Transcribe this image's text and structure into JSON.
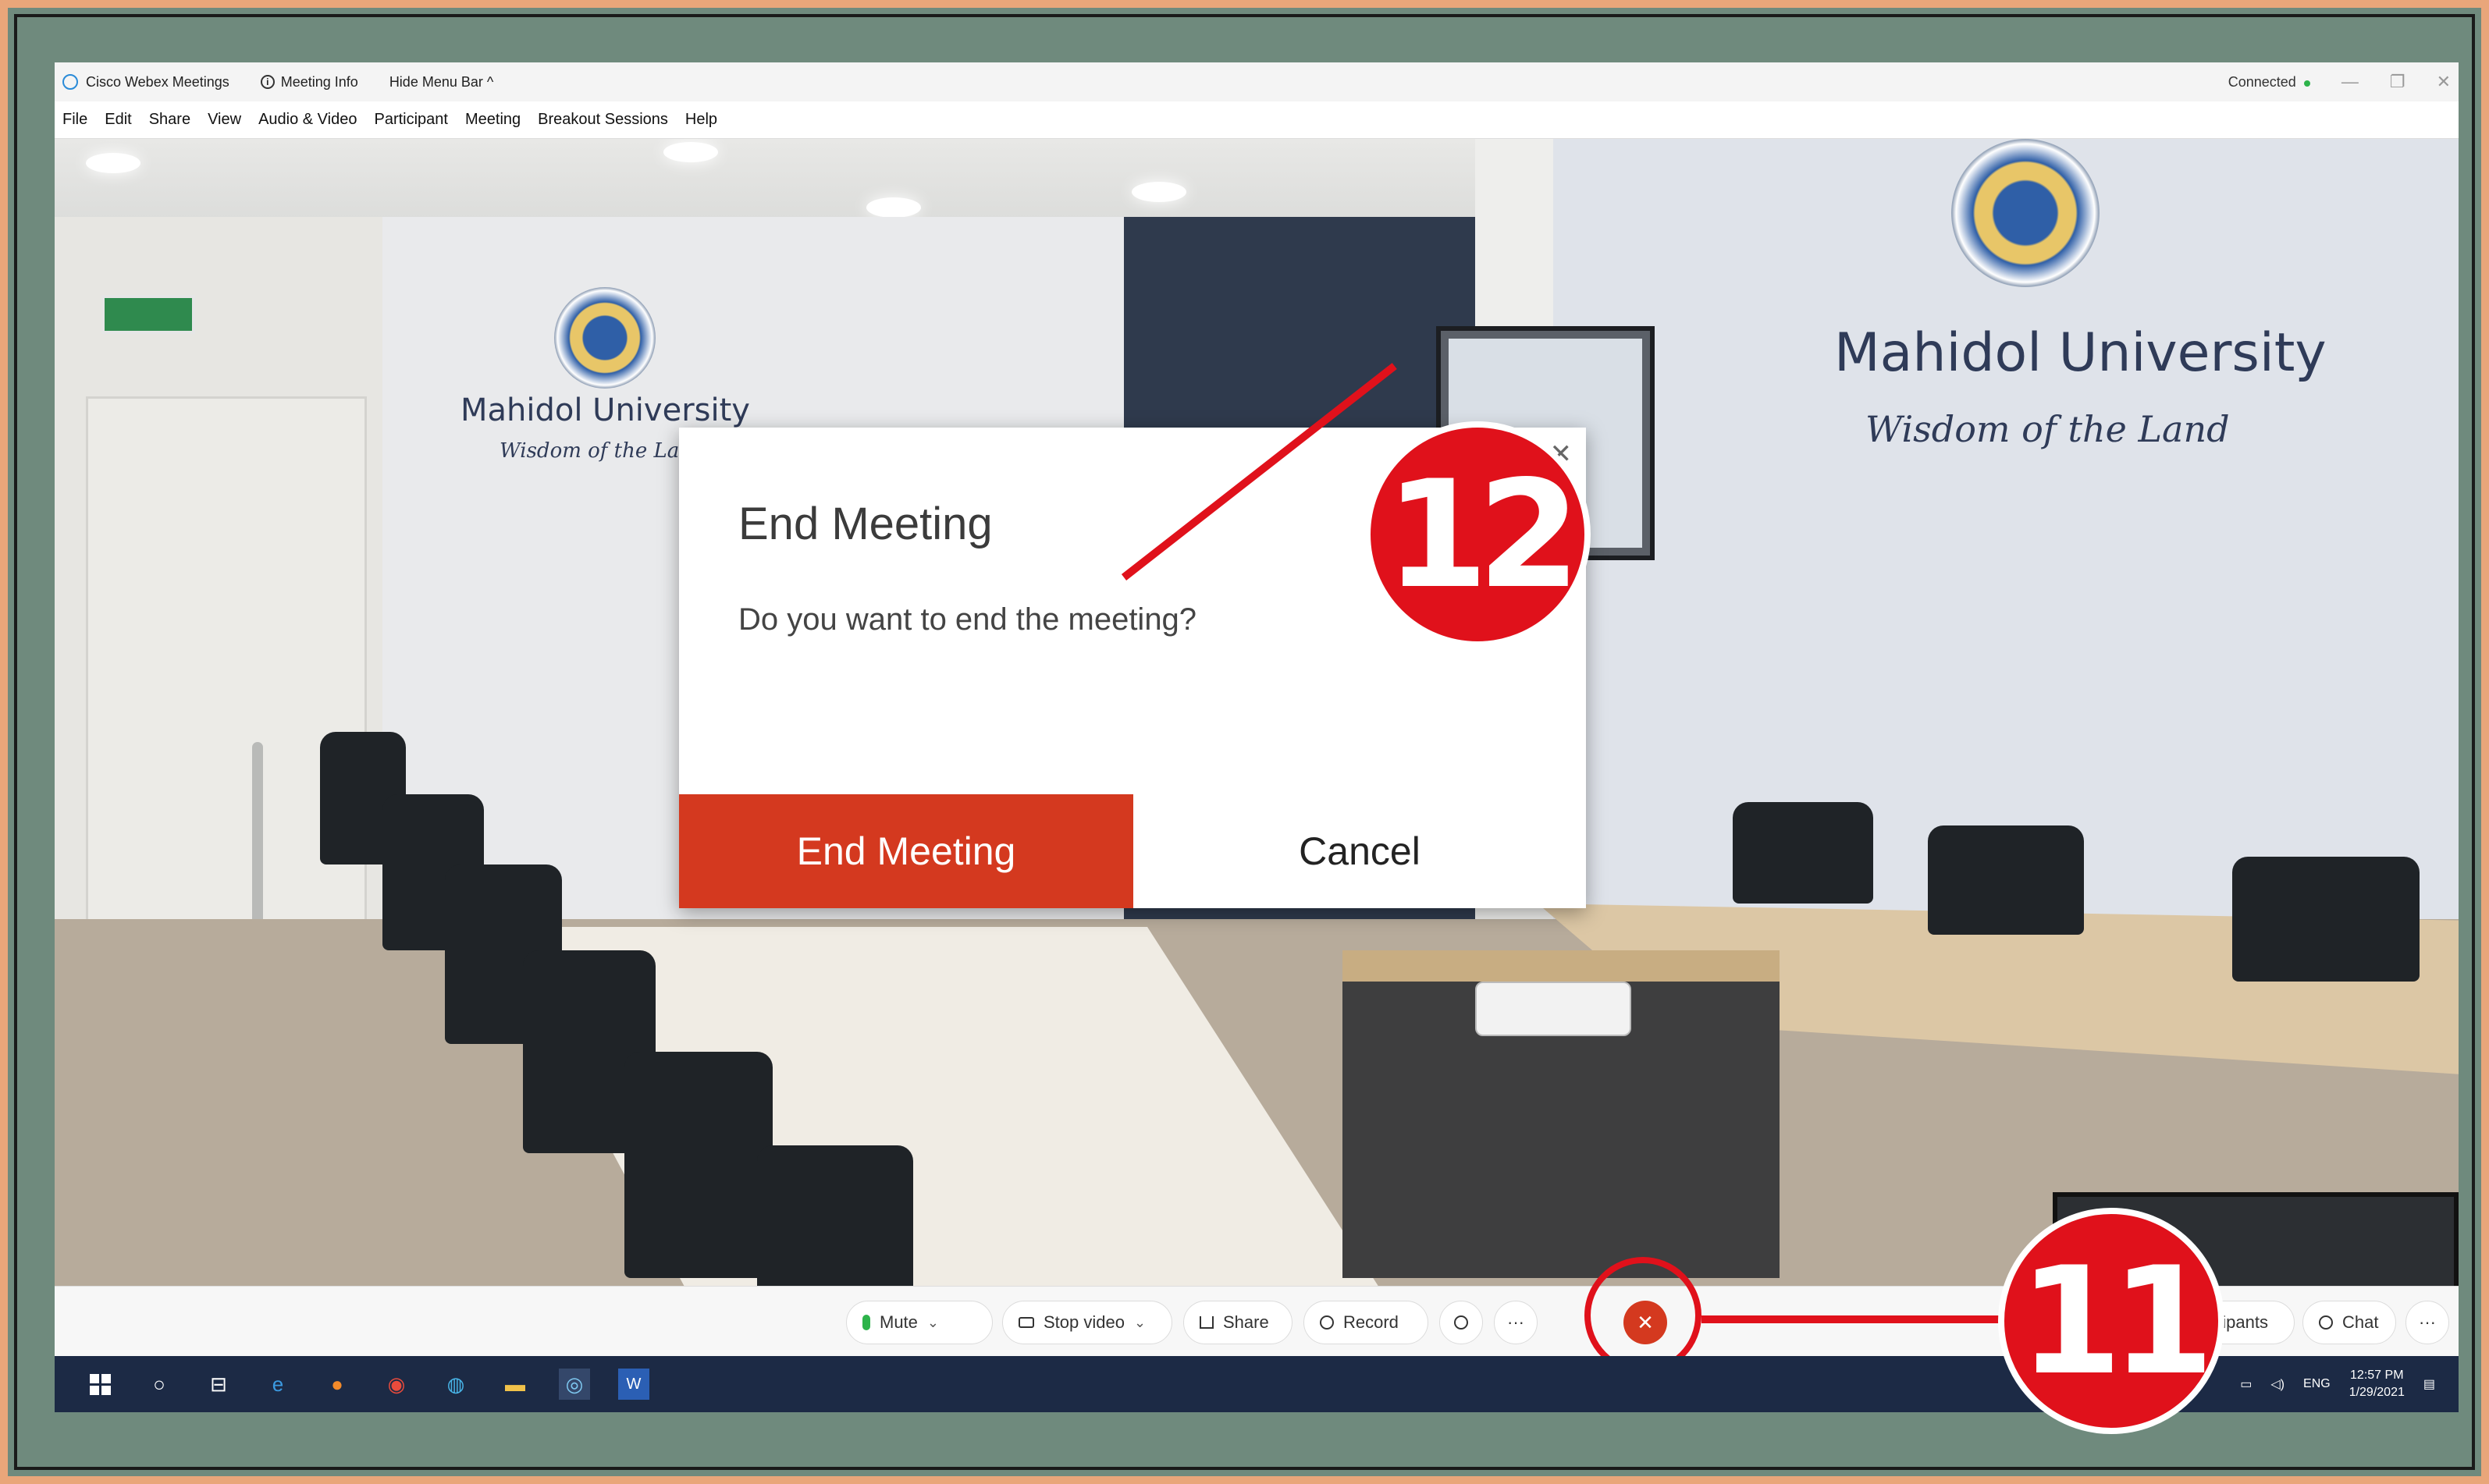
{
  "titlebar": {
    "app_title": "Cisco Webex Meetings",
    "meeting_info": "Meeting Info",
    "hide_menu_bar": "Hide Menu Bar ^",
    "status": "Connected",
    "minimize": "—",
    "restore": "❐",
    "close": "✕"
  },
  "menubar": {
    "items": [
      "File",
      "Edit",
      "Share",
      "View",
      "Audio & Video",
      "Participant",
      "Meeting",
      "Breakout Sessions",
      "Help"
    ]
  },
  "scene": {
    "wall_text_left": "Mahidol University",
    "motto_left": "Wisdom of the Land",
    "wall_text_right": "Mahidol University",
    "motto_right": "Wisdom of the Land"
  },
  "dialog": {
    "title": "End Meeting",
    "message": "Do you want to end the meeting?",
    "close": "✕",
    "end_label": "End Meeting",
    "cancel_label": "Cancel"
  },
  "controls": {
    "mute": "Mute",
    "stop_video": "Stop video",
    "share": "Share",
    "record": "Record",
    "more": "···",
    "end_call": "✕",
    "participants": "Participants",
    "chat": "Chat",
    "more_right": "···",
    "dropdown": "⌄"
  },
  "taskbar": {
    "lang": "ENG",
    "time": "12:57 PM",
    "date": "1/29/2021"
  },
  "callouts": {
    "step_12": "12",
    "step_11": "11"
  },
  "colors": {
    "accent_red": "#d4391f",
    "callout_red": "#e0111b",
    "frame_bg": "#6f8a7d"
  }
}
